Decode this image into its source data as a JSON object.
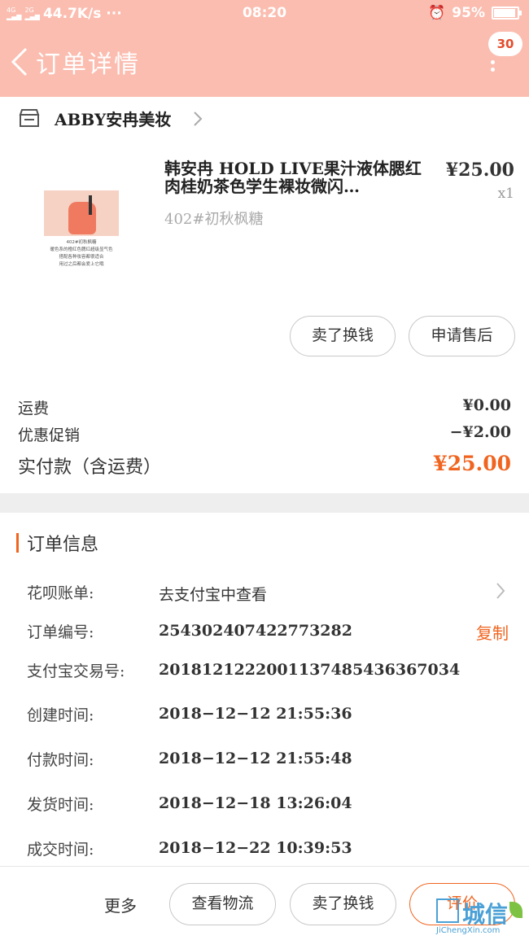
{
  "status_bar": {
    "network": "4G",
    "speed": "44.7K/s ···",
    "time": "08:20",
    "battery": "95%"
  },
  "header": {
    "title": "订单详情",
    "badge_count": "30"
  },
  "shop": {
    "name": "ABBY安冉美妆"
  },
  "product": {
    "title": "韩安冉 HOLD LIVE果汁液体腮红肉桂奶茶色学生裸妆微闪…",
    "price": "¥25.00",
    "qty": "x1",
    "variant": "402#初秋枫糖",
    "image_caption": [
      "402#初秋枫糖",
      "暖色系的橙红色腮红超级显气色",
      "搭配各种妆容都很适合",
      "用过之后都会爱上它哦"
    ]
  },
  "actions": {
    "sell_for_cash": "卖了换钱",
    "after_sale": "申请售后"
  },
  "fees": {
    "shipping_label": "运费",
    "shipping_value": "¥0.00",
    "discount_label": "优惠促销",
    "discount_value": "−¥2.00",
    "paid_label": "实付款（含运费）",
    "paid_symbol": "¥",
    "paid_amount": "25.00"
  },
  "order_info": {
    "heading": "订单信息",
    "huabei_label": "花呗账单:",
    "huabei_value": "去支付宝中查看",
    "order_no_label": "订单编号:",
    "order_no": "254302407422773282",
    "copy_label": "复制",
    "alipay_no_label": "支付宝交易号:",
    "alipay_no": "2018121222001137485436367034",
    "created_label": "创建时间:",
    "created": "2018−12−12 21:55:36",
    "paid_time_label": "付款时间:",
    "paid_time": "2018−12−12 21:55:48",
    "shipped_label": "发货时间:",
    "shipped": "2018−12−18 13:26:04",
    "done_label": "成交时间:",
    "done": "2018−12−22 10:39:53"
  },
  "bottom_bar": {
    "more": "更多",
    "logistics": "查看物流",
    "sell": "卖了换钱",
    "review": "评价"
  },
  "watermark": {
    "brand": "城信",
    "url": "JiChengXin.com"
  },
  "colors": {
    "header_bg": "#fbbdb0",
    "accent": "#f0641f"
  }
}
